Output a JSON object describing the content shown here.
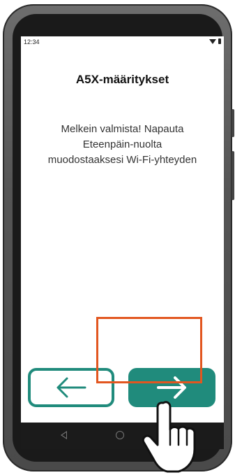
{
  "status_bar": {
    "time": "12:34",
    "icons": [
      "wifi-icon",
      "battery-icon"
    ]
  },
  "screen": {
    "title": "A5X-määritykset",
    "message_lines": [
      "Melkein valmista! Napauta",
      "Eteenpäin-nuolta",
      "muodostaaksesi Wi-Fi-yhteyden"
    ]
  },
  "buttons": {
    "back": {
      "icon": "arrow-left-icon"
    },
    "next": {
      "icon": "arrow-right-icon"
    }
  },
  "nav_bar": {
    "icons": [
      "back-triangle-icon",
      "home-circle-icon"
    ]
  },
  "colors": {
    "accent": "#208b7c",
    "highlight": "#e2561f",
    "phone_frame": "#555555"
  },
  "overlay": {
    "icon": "pointing-hand-icon"
  }
}
